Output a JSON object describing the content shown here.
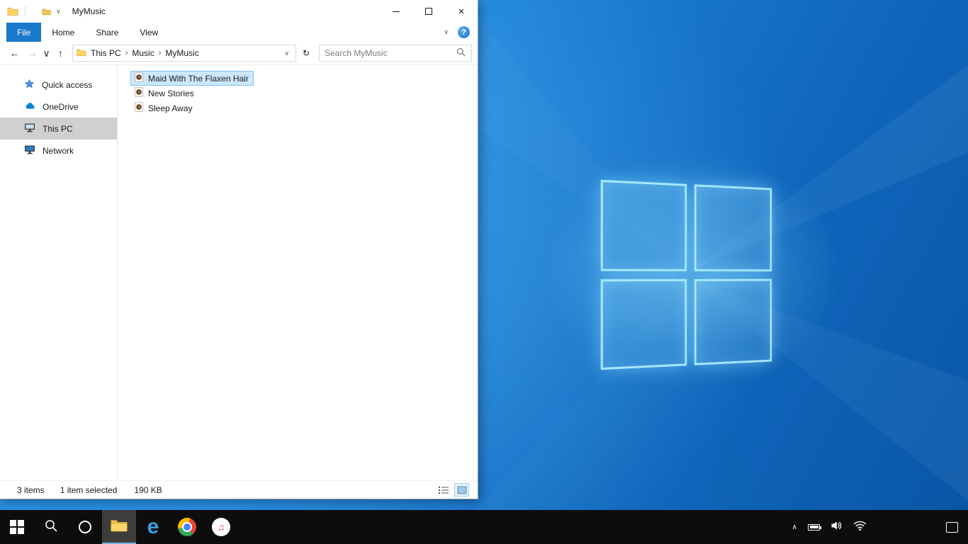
{
  "colors": {
    "accent_blue": "#1979ca",
    "selection_fill": "#cce8ff",
    "selection_border": "#84c3f2",
    "sidebar_selected": "#d0d0d0",
    "taskbar": "#0d0d0d",
    "wallpaper_base": "#1e83d8"
  },
  "icons": {
    "back": "←",
    "forward": "→",
    "up": "↑",
    "chevron_down": "∨",
    "breadcrumb_sep": "›",
    "refresh": "↻",
    "close": "×",
    "help": "?",
    "tray_chevron": "∧",
    "edge_letter": "e",
    "itunes_note": "♫"
  },
  "explorer": {
    "title": "MyMusic",
    "tabs": {
      "file": "File",
      "home": "Home",
      "share": "Share",
      "view": "View"
    },
    "address": {
      "breadcrumb": [
        "This PC",
        "Music",
        "MyMusic"
      ],
      "search_placeholder": "Search MyMusic"
    },
    "sidebar": {
      "items": [
        {
          "label": "Quick access",
          "icon": "star-icon",
          "selected": false
        },
        {
          "label": "OneDrive",
          "icon": "cloud-icon",
          "selected": false
        },
        {
          "label": "This PC",
          "icon": "monitor-icon",
          "selected": true
        },
        {
          "label": "Network",
          "icon": "network-icon",
          "selected": false
        }
      ]
    },
    "files": [
      {
        "name": "Maid With The Flaxen Hair",
        "icon": "music-file-icon",
        "selected": true
      },
      {
        "name": "New Stories",
        "icon": "music-file-icon",
        "selected": false
      },
      {
        "name": "Sleep Away",
        "icon": "music-file-icon",
        "selected": false
      }
    ],
    "status": {
      "count": "3 items",
      "selection": "1 item selected",
      "size": "190 KB"
    }
  },
  "taskbar": {
    "buttons": [
      "start",
      "search",
      "cortana",
      "file-explorer",
      "edge",
      "chrome",
      "itunes"
    ],
    "active_button": "file-explorer",
    "tray": [
      "hidden-icons",
      "battery",
      "speaker",
      "wifi"
    ],
    "action_center": "action-center"
  }
}
